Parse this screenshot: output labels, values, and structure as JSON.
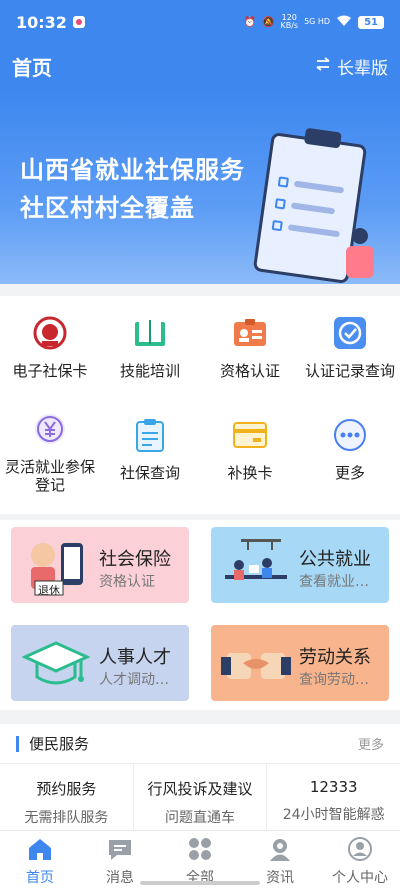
{
  "status_bar": {
    "time": "10:32",
    "net_speed_value": "120",
    "net_speed_unit": "KB/s",
    "network": "5G HD",
    "battery": "51"
  },
  "header": {
    "title": "首页",
    "elder_mode": "长辈版",
    "swap_icon": "swap-icon"
  },
  "banner": {
    "line1": "山西省就业社保服务",
    "line2": "社区村村全覆盖",
    "dots_count": 9,
    "active_dot": 0
  },
  "grid": {
    "items": [
      {
        "label": "电子社保卡",
        "icon": "social-security-card-icon"
      },
      {
        "label": "技能培训",
        "icon": "book-training-icon"
      },
      {
        "label": "资格认证",
        "icon": "id-card-icon"
      },
      {
        "label": "认证记录查询",
        "icon": "verified-badge-icon"
      },
      {
        "label": "灵活就业参保登记",
        "icon": "yen-coin-icon"
      },
      {
        "label": "社保查询",
        "icon": "clipboard-icon"
      },
      {
        "label": "补换卡",
        "icon": "card-icon"
      },
      {
        "label": "更多",
        "icon": "more-icon"
      }
    ]
  },
  "cards": {
    "items": [
      {
        "title": "社会保险",
        "subtitle": "资格认证",
        "bg": "#fbd0d7",
        "art_label": "退休"
      },
      {
        "title": "公共就业",
        "subtitle": "查看就业…",
        "bg": "#a7d8f6"
      },
      {
        "title": "人事人才",
        "subtitle": "人才调动…",
        "bg": "#c6d4ef"
      },
      {
        "title": "劳动关系",
        "subtitle": "查询劳动…",
        "bg": "#f8b48c"
      }
    ]
  },
  "service": {
    "title": "便民服务",
    "more": "更多",
    "columns": [
      {
        "title": "预约服务",
        "desc": "无需排队服务"
      },
      {
        "title": "行风投诉及建议",
        "desc": "问题直通车"
      },
      {
        "title": "12333",
        "desc": "24小时智能解惑"
      }
    ]
  },
  "tabbar": {
    "items": [
      {
        "label": "首页",
        "icon": "home-icon",
        "active": true
      },
      {
        "label": "消息",
        "icon": "message-icon",
        "active": false
      },
      {
        "label": "全部",
        "icon": "grid-icon",
        "active": false
      },
      {
        "label": "资讯",
        "icon": "news-icon",
        "active": false
      },
      {
        "label": "个人中心",
        "icon": "user-icon",
        "active": false
      }
    ]
  },
  "colors": {
    "brand": "#3d87ef",
    "background": "#f2f3f5"
  }
}
